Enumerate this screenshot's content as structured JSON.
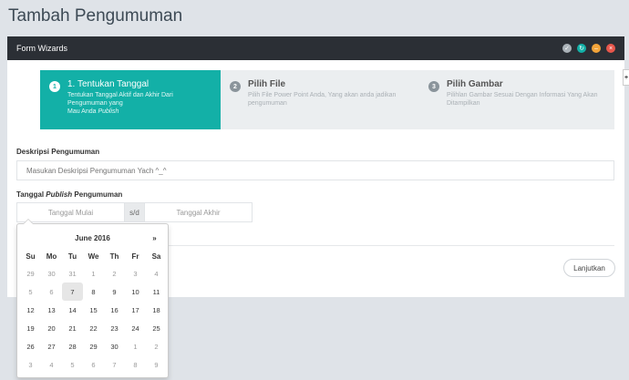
{
  "page_title": "Tambah Pengumuman",
  "panel": {
    "title": "Form Wizards",
    "controls": [
      {
        "name": "settings",
        "color": "#aab2b8",
        "glyph": "✓"
      },
      {
        "name": "refresh",
        "color": "#13b0a7",
        "glyph": "↻"
      },
      {
        "name": "minimize",
        "color": "#f2a43a",
        "glyph": "–"
      },
      {
        "name": "close",
        "color": "#e8574c",
        "glyph": "×"
      }
    ]
  },
  "wizard": {
    "steps": [
      {
        "number": "1",
        "title": "1. Tentukan Tanggal",
        "desc_a": "Tentukan Tanggal Aktif dan Akhir Dari Pengumuman yang",
        "desc_b": "Mau Anda ",
        "desc_em": "Publish"
      },
      {
        "number": "2",
        "title": "Pilih File",
        "desc": "Pilih File Power Point Anda, Yang akan anda jadikan pengumuman"
      },
      {
        "number": "3",
        "title": "Pilih Gambar",
        "desc": "Pilihlan Gambar Sesuai Dengan Informasi Yang Akan Ditampilkan"
      }
    ]
  },
  "form": {
    "desc_label": "Deskripsi Pengumuman",
    "desc_placeholder": "Masukan Deskripsi Pengumuman Yach ^_^",
    "date_label_a": "Tanggal ",
    "date_label_em": "Publish",
    "date_label_b": " Pengumuman",
    "start_placeholder": "Tanggal Mulai",
    "separator": "s/d",
    "end_placeholder": "Tanggal Akhir",
    "next_button": "Lanjutkan"
  },
  "datepicker": {
    "month": "June 2016",
    "prev": "",
    "next": "»",
    "days_of_week": [
      "Su",
      "Mo",
      "Tu",
      "We",
      "Th",
      "Fr",
      "Sa"
    ],
    "weeks": [
      [
        {
          "d": "29",
          "old": true
        },
        {
          "d": "30",
          "old": true
        },
        {
          "d": "31",
          "old": true
        },
        {
          "d": "1",
          "old": true
        },
        {
          "d": "2",
          "old": true
        },
        {
          "d": "3",
          "old": true
        },
        {
          "d": "4",
          "old": true
        }
      ],
      [
        {
          "d": "5",
          "old": true
        },
        {
          "d": "6",
          "old": true
        },
        {
          "d": "7",
          "today": true
        },
        {
          "d": "8"
        },
        {
          "d": "9"
        },
        {
          "d": "10"
        },
        {
          "d": "11"
        }
      ],
      [
        {
          "d": "12"
        },
        {
          "d": "13"
        },
        {
          "d": "14"
        },
        {
          "d": "15"
        },
        {
          "d": "16"
        },
        {
          "d": "17"
        },
        {
          "d": "18"
        }
      ],
      [
        {
          "d": "19"
        },
        {
          "d": "20"
        },
        {
          "d": "21"
        },
        {
          "d": "22"
        },
        {
          "d": "23"
        },
        {
          "d": "24"
        },
        {
          "d": "25"
        }
      ],
      [
        {
          "d": "26"
        },
        {
          "d": "27"
        },
        {
          "d": "28"
        },
        {
          "d": "29"
        },
        {
          "d": "30"
        },
        {
          "d": "1",
          "old": true
        },
        {
          "d": "2",
          "old": true
        }
      ],
      [
        {
          "d": "3",
          "old": true
        },
        {
          "d": "4",
          "old": true
        },
        {
          "d": "5",
          "old": true
        },
        {
          "d": "6",
          "old": true
        },
        {
          "d": "7",
          "old": true
        },
        {
          "d": "8",
          "old": true
        },
        {
          "d": "9",
          "old": true
        }
      ]
    ]
  },
  "side_tab": "+"
}
